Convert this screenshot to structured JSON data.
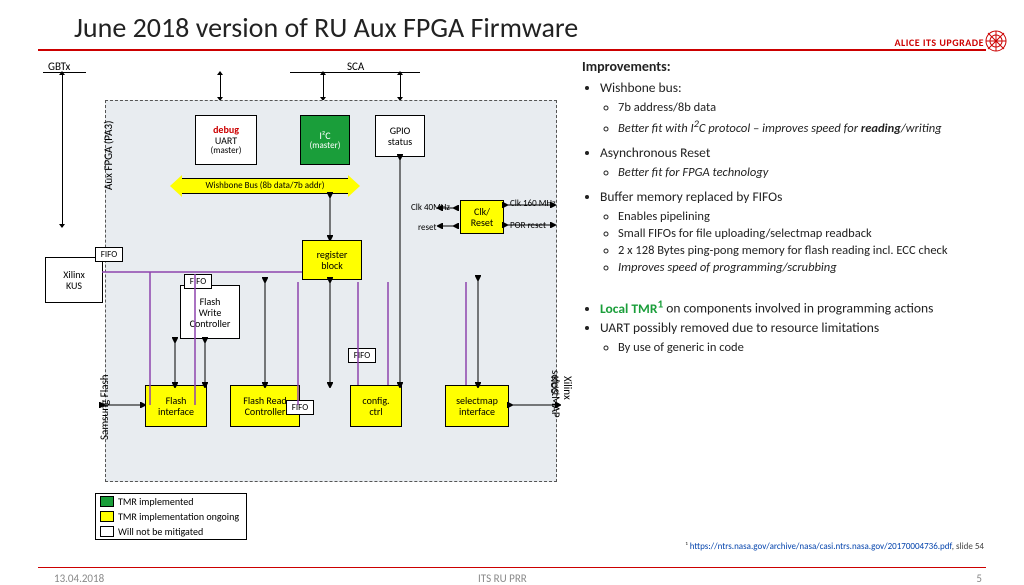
{
  "title": "June 2018 version of RU Aux FPGA Firmware",
  "brand": "ALICE ITS UPGRADE",
  "diagram": {
    "gbtx": "GBTx",
    "sca": "SCA",
    "auxfpga": "Aux FPGA (PA3)",
    "uart_debug": "debug",
    "uart": "UART",
    "uart_sub": "(master)",
    "i2c": "I²C",
    "i2c_sub": "(master)",
    "gpio": "GPIO\nstatus",
    "wishbone": "Wishbone Bus (8b data/7b addr)",
    "regblock": "register\nblock",
    "clkreset": "Clk/\nReset",
    "clk40": "Clk 40MHz",
    "clk160": "Clk 160 MHz",
    "reset": "reset",
    "por": "POR reset",
    "xilinx": "Xilinx\nKUS",
    "fifo": "FIFO",
    "fwc": "Flash\nWrite\nController",
    "flashif": "Flash\ninterface",
    "frc": "Flash Read\nController",
    "cfgctrl": "config.\nctrl",
    "selectmap": "selectmap\ninterface",
    "samsung": "Samsung Flash",
    "selMAP": "selectMAP",
    "xkus": "Xilinx KUS"
  },
  "legend": {
    "tmr_impl": "TMR implemented",
    "tmr_ong": "TMR implementation ongoing",
    "no_mit": "Will not be mitigated"
  },
  "improvements": {
    "heading": "Improvements:",
    "wb": {
      "t": "Wishbone bus:",
      "a": "7b address/8b data",
      "b_pre": "Better fit with I",
      "b_sup": "2",
      "b_post": "C protocol – improves speed for ",
      "b_strong": "reading",
      "b_tail": "/writing"
    },
    "ar": {
      "t": "Asynchronous Reset",
      "a": "Better fit for FPGA technology"
    },
    "fifo": {
      "t": "Buffer memory replaced by FIFOs",
      "a": "Enables pipelining",
      "b": "Small FIFOs for file uploading/selectmap readback",
      "c": "2 x 128 Bytes ping-pong memory for flash reading incl. ECC check",
      "d": "Improves speed of programming/scrubbing"
    },
    "tmr": {
      "t_pre": "Local TMR",
      "t_sup": "1",
      "t_post": " on components involved in programming actions"
    },
    "uart": {
      "t": "UART possibly removed due to resource limitations",
      "a": "By use of generic in code"
    }
  },
  "cite": {
    "pre": "¹ ",
    "url": "https://ntrs.nasa.gov/archive/nasa/casi.ntrs.nasa.gov/20170004736.pdf",
    "post": ", slide 54"
  },
  "footer": {
    "date": "13.04.2018",
    "center": "ITS RU PRR",
    "page": "5"
  }
}
